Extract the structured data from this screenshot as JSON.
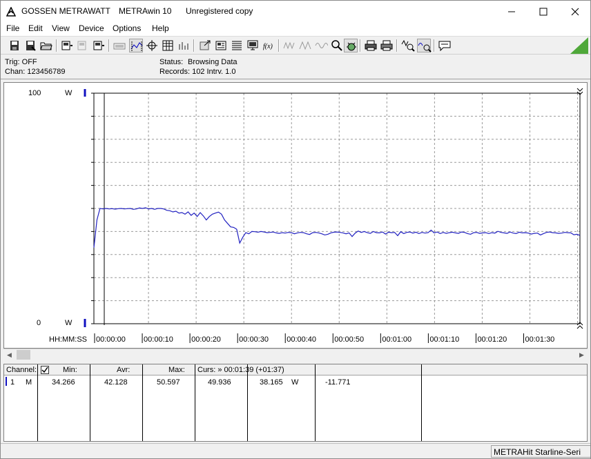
{
  "window": {
    "brand": "GOSSEN METRAWATT",
    "app_name": "METRAwin 10",
    "license": "Unregistered copy"
  },
  "menu": [
    "File",
    "Edit",
    "View",
    "Device",
    "Options",
    "Help"
  ],
  "toolbar_icons": [
    "save-icon",
    "save-as-icon",
    "open-icon",
    "device-read-icon",
    "device-disabled-icon",
    "device-write-icon",
    "keyboard-icon",
    "zoom-fit-icon",
    "crosshair-icon",
    "table-icon",
    "bars-icon",
    "export-icon",
    "print-setup-icon",
    "list-icon",
    "computer-icon",
    "function-icon",
    "wave-icon",
    "triangle-wave-icon",
    "sine-icon",
    "search-icon",
    "bug-icon",
    "printer-icon",
    "printer-alt-icon",
    "zoom-signal-icon",
    "zoom-wave-icon",
    "message-icon"
  ],
  "info": {
    "trig": "Trig: OFF",
    "chan": "Chan:  123456789",
    "status_label": "Status:",
    "status_value": "Browsing Data",
    "records": "Records: 102  Intrv. 1.0"
  },
  "chart_data": {
    "type": "line",
    "y_top_label": "100",
    "y_bottom_label": "0",
    "y_unit": "W",
    "ylim": [
      0,
      100
    ],
    "xlim": [
      0,
      99
    ],
    "x_axis_label": "HH:MM:SS",
    "x_tick_labels": [
      "00:00:00",
      "00:00:10",
      "00:00:20",
      "00:00:30",
      "00:00:40",
      "00:00:50",
      "00:01:00",
      "00:01:10",
      "00:01:20",
      "00:01:30"
    ],
    "grid": true,
    "line_color": "#2020c0",
    "series": [
      {
        "values": [
          33,
          45,
          50,
          49.8,
          50,
          49.8,
          49.9,
          49.7,
          49.9,
          50,
          49.8,
          49.9,
          50,
          49.6,
          49.8,
          50.2,
          50,
          50.3,
          49.8,
          50,
          49.6,
          50,
          50,
          49.8,
          49.2,
          49,
          48.5,
          48.8,
          48,
          48.2,
          47.5,
          48.5,
          47,
          48,
          46.5,
          48.2,
          46.8,
          45,
          46.5,
          47.5,
          48,
          48.4,
          47.5,
          45,
          43.5,
          42,
          41.8,
          41,
          35,
          37.5,
          39.5,
          39,
          40,
          39.9,
          39.7,
          40,
          39.8,
          39.5,
          39.6,
          39.8,
          39.4,
          39.2,
          39.5,
          39.3,
          39.6,
          39.5,
          39,
          39.4,
          39.6,
          39.5,
          39,
          38.7,
          39.5,
          39.6,
          39.4,
          39,
          38.5,
          38.8,
          39.4,
          39.7,
          39.8,
          39.6,
          39.4,
          39,
          39.4,
          37.8,
          39.3,
          40.2,
          39.6,
          40,
          39.5,
          39.2,
          40,
          39.5,
          39.4,
          39.8,
          38.9,
          39.7,
          39.5,
          39.6,
          38.2,
          39.9,
          39.1,
          39.6,
          39.8,
          39.3,
          39.7,
          39.1,
          39.6,
          39.3,
          39.5,
          40.6,
          39.4,
          39.8,
          39.1,
          39.6,
          39.2,
          39.5,
          39.7,
          39.4,
          39.2,
          39.8,
          39.6,
          39.1,
          38.8,
          39.5,
          39.6,
          39.2,
          39.4,
          39.5,
          39.1,
          39.5,
          39.3,
          40.1,
          39.6,
          39.4,
          39.2,
          39.8,
          39.3,
          39.1,
          39.7,
          39.4,
          39.5,
          39.3,
          38.9,
          39.2,
          39.3,
          38.5,
          39.1,
          39.6,
          39.8,
          39.5,
          39.4,
          39.2,
          39.3,
          39.6,
          39.5,
          39.4,
          38.6,
          38.8,
          38.3
        ]
      }
    ]
  },
  "table": {
    "headers": {
      "channel": "Channel:",
      "min": "Min:",
      "avr": "Avr:",
      "max": "Max:",
      "cursor": "Curs: » 00:01:39 (+01:37)"
    },
    "row": {
      "num": "1",
      "mode": "M",
      "min": "34.266",
      "avr": "42.128",
      "max": "50.597",
      "cursor_value": "49.936",
      "value2": "38.165",
      "unit": "W",
      "delta": "-11.771"
    }
  },
  "statusbar": {
    "device": "METRAHit Starline-Seri"
  }
}
